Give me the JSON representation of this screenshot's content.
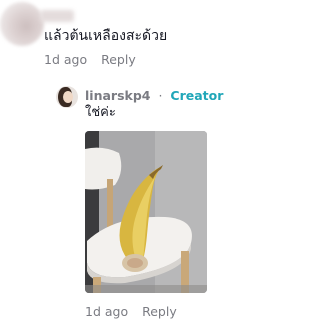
{
  "top_comment": {
    "text": "แล้วต้นเหลืองสะด้วย",
    "time": "1d ago",
    "reply_label": "Reply"
  },
  "reply_comment": {
    "username": "linarskp4",
    "separator": "·",
    "badge": "Creator",
    "text": "ใช่ค่ะ",
    "time": "1d ago",
    "reply_label": "Reply"
  },
  "colors": {
    "creator_badge": "#20a6b8",
    "meta_text": "#7a7b82",
    "body_text": "#161823"
  }
}
